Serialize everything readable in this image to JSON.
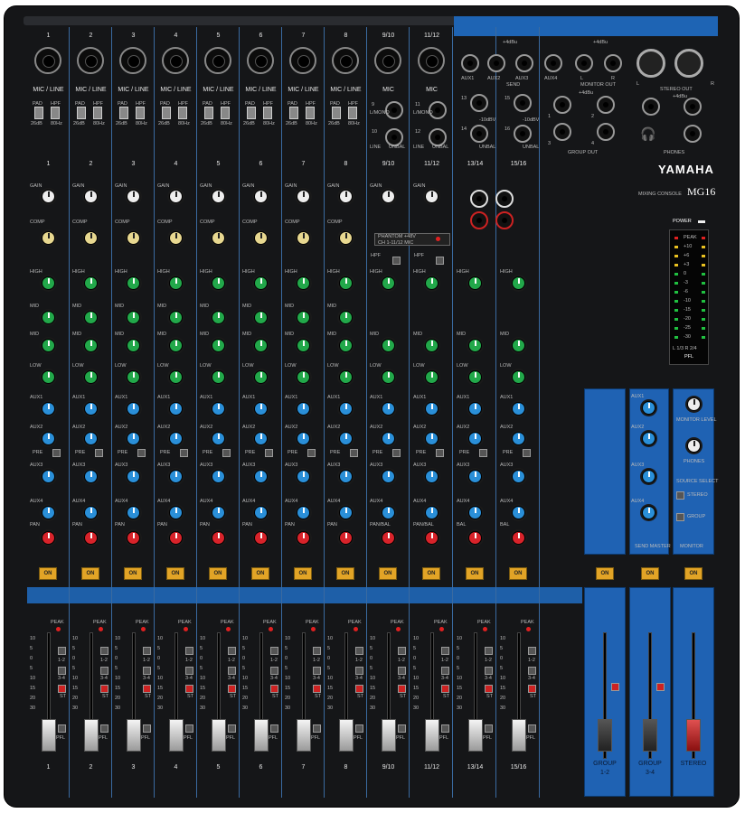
{
  "brand": "YAMAHA",
  "model": "MG16",
  "model_caption": "MIXING CONSOLE",
  "power_label": "POWER",
  "mono_channels": [
    {
      "num": "1",
      "type": "MIC / LINE"
    },
    {
      "num": "2",
      "type": "MIC / LINE"
    },
    {
      "num": "3",
      "type": "MIC / LINE"
    },
    {
      "num": "4",
      "type": "MIC / LINE"
    },
    {
      "num": "5",
      "type": "MIC / LINE"
    },
    {
      "num": "6",
      "type": "MIC / LINE"
    },
    {
      "num": "7",
      "type": "MIC / LINE"
    },
    {
      "num": "8",
      "type": "MIC / LINE"
    }
  ],
  "stereo_channels": [
    {
      "num": "9/10",
      "type": "MIC"
    },
    {
      "num": "11/12",
      "type": "MIC"
    }
  ],
  "switch_labels": {
    "pad": "PAD",
    "pad_value": "26dB",
    "hpf": "HPF",
    "hpf_value": "80Hz"
  },
  "stereo_inputs": {
    "l_mono": "L/MONO",
    "r": "R",
    "line": "LINE",
    "unbal": "UNBAL",
    "unbal_label": "UNBAL",
    "minus10": "-10dBV",
    "ch_labels": [
      "9",
      "10",
      "11",
      "12",
      "13",
      "14",
      "15",
      "16"
    ]
  },
  "send": {
    "title": "SEND",
    "level": "+4dBu",
    "jacks": [
      "AUX1",
      "AUX2",
      "AUX3",
      "AUX4"
    ]
  },
  "monitor_out": {
    "title": "MONITOR OUT",
    "level": "+4dBu",
    "l": "L",
    "r": "R"
  },
  "stereo_out": {
    "title": "STEREO OUT",
    "level": "+4dBu",
    "l": "L",
    "r": "R"
  },
  "group_out": {
    "title": "GROUP OUT",
    "level": "+4dBu",
    "nums": [
      "1",
      "2",
      "3",
      "4"
    ]
  },
  "phones": "PHONES",
  "strip_numbers": [
    "1",
    "2",
    "3",
    "4",
    "5",
    "6",
    "7",
    "8",
    "9/10",
    "11/12",
    "13/14",
    "15/16"
  ],
  "knob_labels": {
    "gain": "GAIN",
    "comp": "COMP",
    "high": "HIGH",
    "high_freq": "10kHz",
    "mid": "MID",
    "mid_freq": "2.5kHz",
    "low": "LOW",
    "low_freq": "100Hz",
    "aux1": "AUX1",
    "aux2": "AUX2",
    "aux3": "AUX3",
    "aux4": "AUX4",
    "pre": "PRE",
    "pan": "PAN",
    "pan_bal": "PAN/BAL",
    "bal": "BAL"
  },
  "phantom": {
    "label": "PHANTOM +48V",
    "sub": "CH 1-11/12 MIC"
  },
  "hpf_stereo": {
    "label": "HPF",
    "value": "80Hz",
    "mic": "(MIC)"
  },
  "on_label": "ON",
  "fader_labels": {
    "peak": "PEAK",
    "g12": "1-2",
    "g34": "3-4",
    "st": "ST",
    "pfl": "PFL",
    "scale": [
      "10",
      "5",
      "0",
      "5",
      "10",
      "15",
      "20",
      "30",
      "40",
      "50",
      "∞"
    ]
  },
  "master": {
    "send_master": "SEND MASTER",
    "monitor": "MONITOR",
    "monitor_level": "MONITOR LEVEL",
    "phones_level": "PHONES",
    "source_select": "SOURCE SELECT",
    "stereo": "STEREO",
    "group": "GROUP",
    "aux": [
      "AUX1",
      "AUX2",
      "AUX3",
      "AUX4"
    ]
  },
  "master_faders": [
    {
      "label": "GROUP",
      "sub": "1-2"
    },
    {
      "label": "GROUP",
      "sub": "3-4"
    },
    {
      "label": "STEREO",
      "sub": ""
    }
  ],
  "meter": {
    "title": "PFL",
    "scale": [
      "PEAK",
      "+10",
      "+6",
      "+3",
      "0",
      "-3",
      "-6",
      "-10",
      "-15",
      "-20",
      "-25",
      "-30"
    ],
    "channels": "L 1/3  R 2/4"
  }
}
